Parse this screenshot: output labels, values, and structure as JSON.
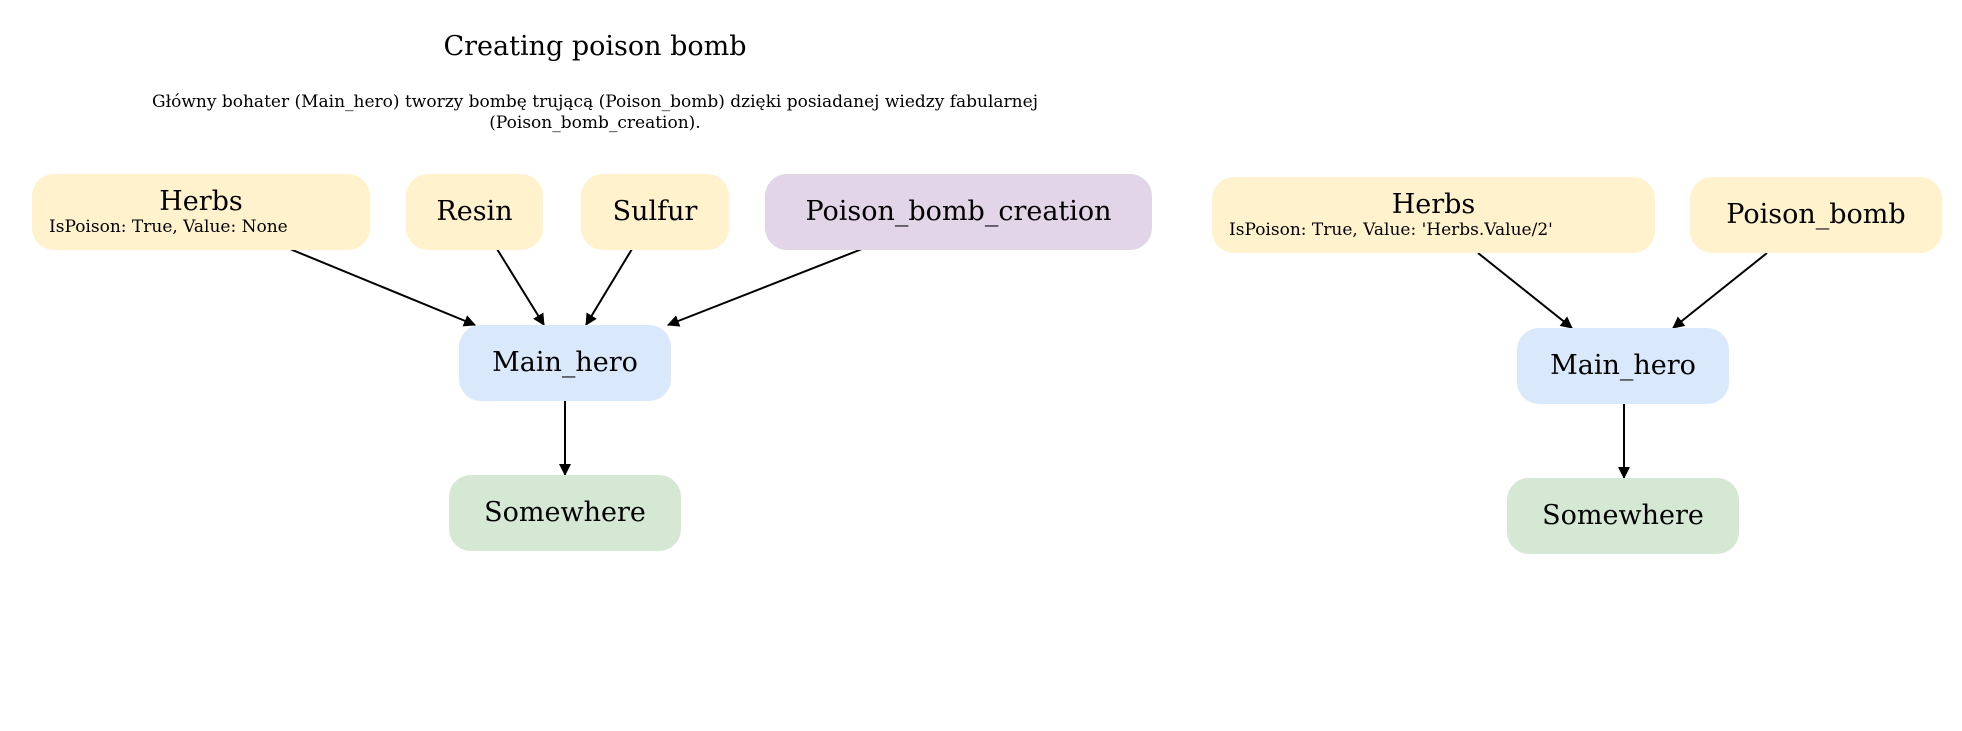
{
  "title": "Creating poison bomb",
  "subtitle": {
    "line1": "Główny bohater (Main_hero) tworzy bombę trującą (Poison_bomb) dzięki posiadanej wiedzy fabularnej",
    "line2": "(Poison_bomb_creation)."
  },
  "colors": {
    "item": "#fff2cc",
    "knowledge": "#e1d5e7",
    "character": "#dae8fc",
    "location": "#d5e8d4",
    "edge": "#000000"
  },
  "left_graph": {
    "nodes": {
      "herbs": {
        "label": "Herbs",
        "attrs": "IsPoison: True, Value: None",
        "kind": "item"
      },
      "resin": {
        "label": "Resin",
        "kind": "item"
      },
      "sulfur": {
        "label": "Sulfur",
        "kind": "item"
      },
      "creation": {
        "label": "Poison_bomb_creation",
        "kind": "knowledge"
      },
      "hero": {
        "label": "Main_hero",
        "kind": "character"
      },
      "place": {
        "label": "Somewhere",
        "kind": "location"
      }
    },
    "edges": [
      [
        "herbs",
        "hero"
      ],
      [
        "resin",
        "hero"
      ],
      [
        "sulfur",
        "hero"
      ],
      [
        "creation",
        "hero"
      ],
      [
        "hero",
        "place"
      ]
    ]
  },
  "right_graph": {
    "nodes": {
      "herbs": {
        "label": "Herbs",
        "attrs": "IsPoison: True, Value: 'Herbs.Value/2'",
        "kind": "item"
      },
      "bomb": {
        "label": "Poison_bomb",
        "kind": "item"
      },
      "hero": {
        "label": "Main_hero",
        "kind": "character"
      },
      "place": {
        "label": "Somewhere",
        "kind": "location"
      }
    },
    "edges": [
      [
        "herbs",
        "hero"
      ],
      [
        "bomb",
        "hero"
      ],
      [
        "hero",
        "place"
      ]
    ]
  }
}
